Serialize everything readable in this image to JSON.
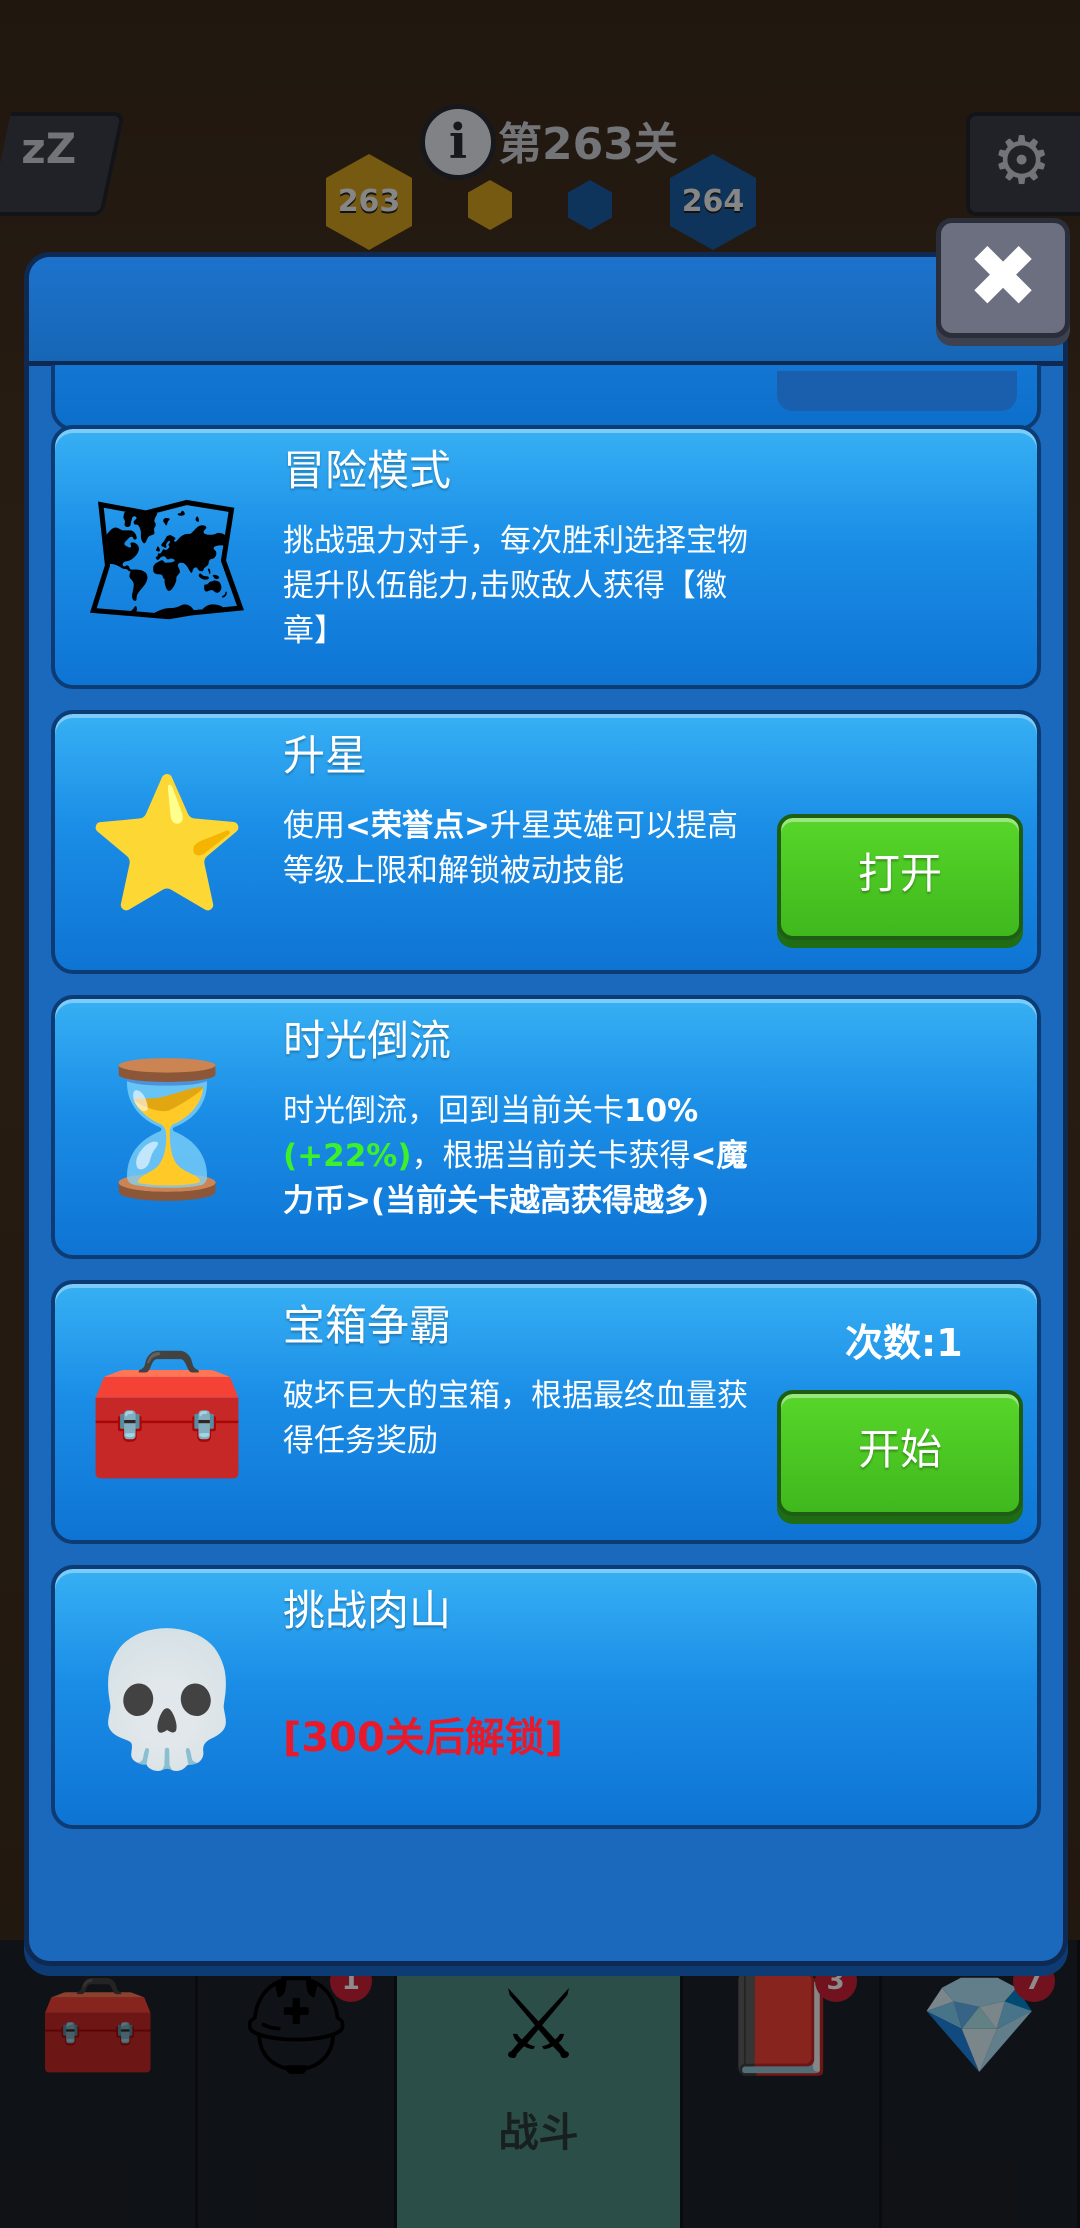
{
  "header": {
    "level_label": "第263关",
    "hex_current": "263",
    "hex_next": "264"
  },
  "modal": {
    "cards": [
      {
        "title": "冒险模式",
        "icon": "treasure-map-icon",
        "description": "挑战强力对手，每次胜利选择宝物提升队伍能力,击败敌人获得【徽章】"
      },
      {
        "title": "升星",
        "icon": "star-icon",
        "description_parts": [
          "使用",
          "<荣誉点>",
          "升星英雄可以提高等级上限和解锁被动技能"
        ],
        "button": "打开"
      },
      {
        "title": "时光倒流",
        "icon": "hourglass-icon",
        "description_parts": [
          "时光倒流，回到当前关卡",
          "10%",
          "(+22%)",
          "，根据当前关卡获得",
          "<魔力币>",
          "(当前关卡越高获得越多)"
        ]
      },
      {
        "title": "宝箱争霸",
        "icon": "treasure-chest-icon",
        "count": "次数:1",
        "description": "破坏巨大的宝箱，根据最终血量获得任务奖励",
        "button": "开始"
      },
      {
        "title": "挑战肉山",
        "icon": "skull-icon",
        "locked_text": "[300关后解锁]"
      }
    ]
  },
  "bottom_nav": {
    "items": [
      {
        "icon": "chest-icon",
        "badge": ""
      },
      {
        "icon": "viking-helmet-icon",
        "badge": "1"
      },
      {
        "icon": "crossed-swords-icon",
        "label": "战斗",
        "badge": ""
      },
      {
        "icon": "spellbook-icon",
        "badge": "3"
      },
      {
        "icon": "amulet-icon",
        "badge": "7"
      }
    ]
  }
}
